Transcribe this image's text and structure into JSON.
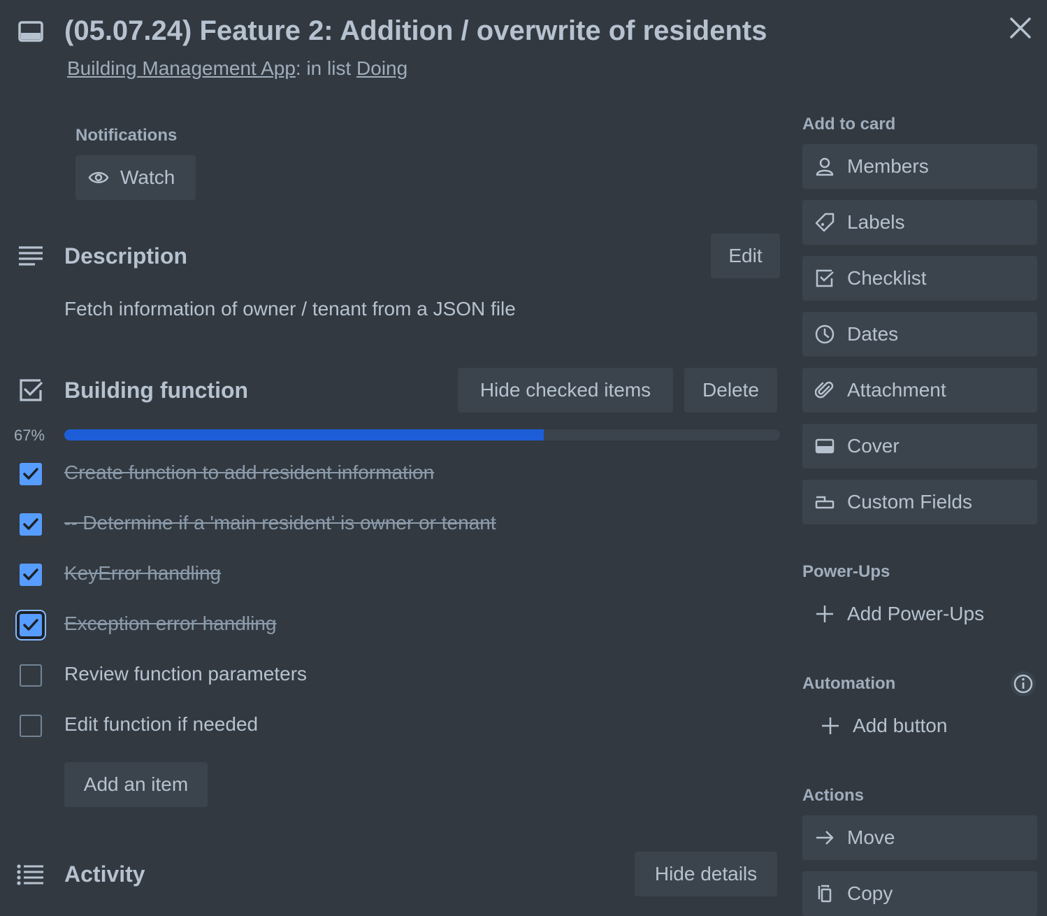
{
  "header": {
    "title": "(05.07.24) Feature 2: Addition / overwrite of residents",
    "board_link": "Building Management App",
    "in_list_text": ": in list ",
    "list_link": "Doing"
  },
  "notifications": {
    "label": "Notifications",
    "watch_label": "Watch"
  },
  "description": {
    "title": "Description",
    "edit_label": "Edit",
    "text": "Fetch information of owner / tenant from a JSON file"
  },
  "checklist": {
    "title": "Building function",
    "hide_checked_label": "Hide checked items",
    "delete_label": "Delete",
    "progress_percent": 67,
    "progress_label": "67%",
    "items": [
      {
        "text": "Create function to add resident information",
        "checked": true
      },
      {
        "text": "-- Determine if a 'main resident' is owner or tenant",
        "checked": true
      },
      {
        "text": "KeyError handling",
        "checked": true
      },
      {
        "text": "Exception error handling",
        "checked": true
      },
      {
        "text": "Review function parameters",
        "checked": false
      },
      {
        "text": "Edit function if needed",
        "checked": false
      }
    ],
    "add_item_label": "Add an item"
  },
  "activity": {
    "title": "Activity",
    "hide_details_label": "Hide details"
  },
  "sidebar": {
    "add_to_card_label": "Add to card",
    "buttons": [
      {
        "label": "Members",
        "icon": "person-icon"
      },
      {
        "label": "Labels",
        "icon": "tag-icon"
      },
      {
        "label": "Checklist",
        "icon": "checklist-icon"
      },
      {
        "label": "Dates",
        "icon": "clock-icon"
      },
      {
        "label": "Attachment",
        "icon": "paperclip-icon"
      },
      {
        "label": "Cover",
        "icon": "cover-icon"
      },
      {
        "label": "Custom Fields",
        "icon": "custom-fields-icon"
      }
    ],
    "power_ups_label": "Power-Ups",
    "add_power_ups_label": "Add Power-Ups",
    "automation_label": "Automation",
    "add_button_label": "Add button",
    "actions_label": "Actions",
    "move_label": "Move",
    "copy_label": "Copy"
  },
  "colors": {
    "background": "#323940",
    "button": "#3b444c",
    "progress": "#1d5ed8",
    "checkbox": "#579dff"
  }
}
